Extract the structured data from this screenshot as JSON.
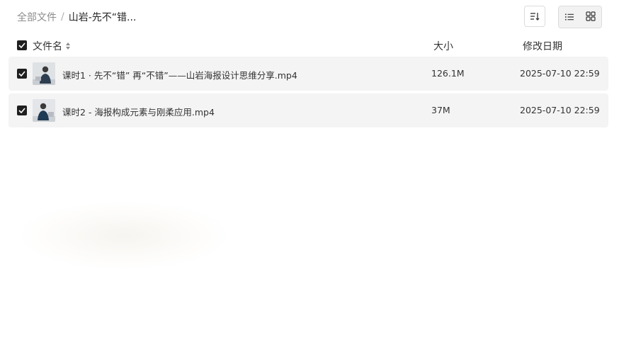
{
  "breadcrumb": {
    "root": "全部文件",
    "separator": "/",
    "current": "山岩-先不“错..."
  },
  "toolbar": {
    "sort_icon": "sort-lines-icon",
    "list_view_icon": "list-view-icon",
    "grid_view_icon": "grid-view-icon",
    "active_view": "list"
  },
  "table": {
    "headers": {
      "name": "文件名",
      "size": "大小",
      "date": "修改日期"
    },
    "rows": [
      {
        "name": "课时1 · 先不“错” 再“不错”——山岩海报设计思维分享.mp4",
        "size": "126.1M",
        "date": "2025-07-10 22:59",
        "checked": true
      },
      {
        "name": "课时2 - 海报构成元素与刚柔应用.mp4",
        "size": "37M",
        "date": "2025-07-10 22:59",
        "checked": true
      }
    ]
  },
  "colors": {
    "row_bg": "#f4f4f4",
    "checkbox": "#1f1f1f",
    "muted_text": "#8c8c8c"
  }
}
